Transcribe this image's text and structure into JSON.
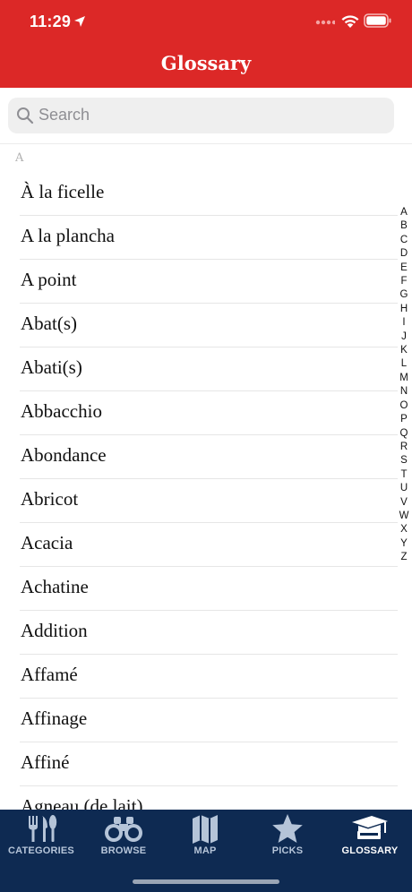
{
  "status_bar": {
    "time": "11:29"
  },
  "header": {
    "title": "Glossary"
  },
  "search": {
    "placeholder": "Search"
  },
  "section": {
    "label": "A"
  },
  "entries": [
    "À la ficelle",
    "A la plancha",
    "A point",
    "Abat(s)",
    "Abati(s)",
    "Abbacchio",
    "Abondance",
    "Abricot",
    "Acacia",
    "Achatine",
    "Addition",
    "Affamé",
    "Affinage",
    "Affiné",
    "Agneau (de lait)"
  ],
  "index_letters": [
    "A",
    "B",
    "C",
    "D",
    "E",
    "F",
    "G",
    "H",
    "I",
    "J",
    "K",
    "L",
    "M",
    "N",
    "O",
    "P",
    "Q",
    "R",
    "S",
    "T",
    "U",
    "V",
    "W",
    "X",
    "Y",
    "Z"
  ],
  "tabs": [
    {
      "label": "CATEGORIES",
      "icon": "utensils-icon",
      "active": false
    },
    {
      "label": "BROWSE",
      "icon": "binoculars-icon",
      "active": false
    },
    {
      "label": "MAP",
      "icon": "map-icon",
      "active": false
    },
    {
      "label": "PICKS",
      "icon": "star-icon",
      "active": false
    },
    {
      "label": "GLOSSARY",
      "icon": "graduation-cap-icon",
      "active": true
    }
  ],
  "colors": {
    "header": "#dc2827",
    "tabbar": "#0e2a52",
    "tab_inactive": "#b5c4d8",
    "tab_active": "#ffffff"
  }
}
